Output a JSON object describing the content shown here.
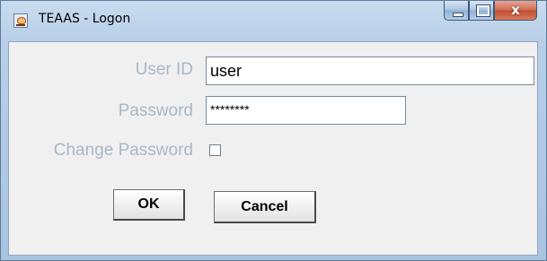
{
  "window": {
    "title": "TEAAS - Logon",
    "close_glyph": "x",
    "icon": "java-cup-icon"
  },
  "form": {
    "user_id_label": "User ID",
    "user_id_value": "user",
    "password_label": "Password",
    "password_value": "********",
    "change_password_label": "Change Password",
    "change_password_checked": false
  },
  "buttons": {
    "ok_label": "OK",
    "cancel_label": "Cancel"
  },
  "colors": {
    "label_text": "#a8b8c8",
    "panel_background": "#f0f0f0",
    "titlebar": "#b8cfe7",
    "close_button": "#c14a2f"
  }
}
